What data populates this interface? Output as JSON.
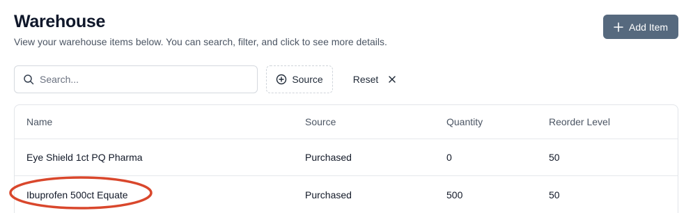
{
  "header": {
    "title": "Warehouse",
    "subtitle": "View your warehouse items below. You can search, filter, and click to see more details.",
    "add_button_label": "Add Item"
  },
  "toolbar": {
    "search_placeholder": "Search...",
    "search_value": "",
    "source_filter_label": "Source",
    "reset_label": "Reset"
  },
  "table": {
    "columns": [
      "Name",
      "Source",
      "Quantity",
      "Reorder Level"
    ],
    "rows": [
      {
        "name": "Eye Shield 1ct PQ Pharma",
        "source": "Purchased",
        "quantity": "0",
        "reorder_level": "50"
      },
      {
        "name": "Ibuprofen 500ct Equate",
        "source": "Purchased",
        "quantity": "500",
        "reorder_level": "50"
      }
    ]
  },
  "colors": {
    "primary_button": "#56697e",
    "annotation": "#d9472c"
  },
  "icons": {
    "add": "plus-icon",
    "search": "search-icon",
    "source": "plus-circle-icon",
    "reset": "close-icon"
  }
}
